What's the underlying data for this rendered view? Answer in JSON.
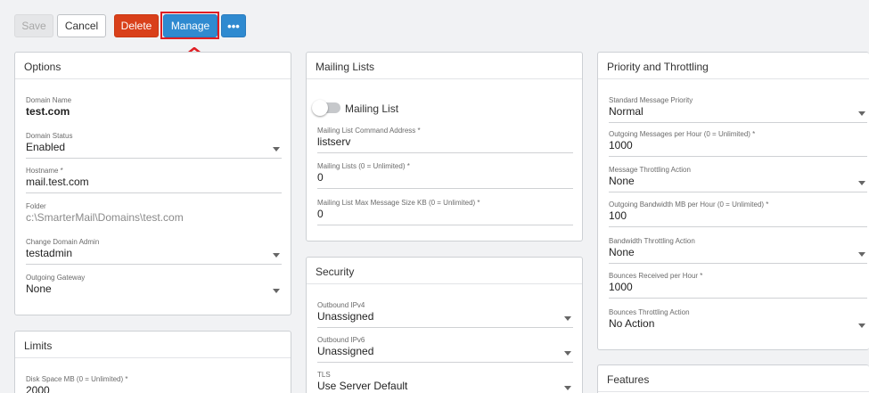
{
  "toolbar": {
    "save": "Save",
    "cancel": "Cancel",
    "delete": "Delete",
    "manage": "Manage",
    "more": "•••"
  },
  "options": {
    "title": "Options",
    "domain_name_label": "Domain Name",
    "domain_name_value": "test.com",
    "domain_status_label": "Domain Status",
    "domain_status_value": "Enabled",
    "hostname_label": "Hostname *",
    "hostname_value": "mail.test.com",
    "folder_label": "Folder",
    "folder_value": "c:\\SmarterMail\\Domains\\test.com",
    "change_admin_label": "Change Domain Admin",
    "change_admin_value": "testadmin",
    "outgoing_gateway_label": "Outgoing Gateway",
    "outgoing_gateway_value": "None"
  },
  "limits": {
    "title": "Limits",
    "disk_space_label": "Disk Space MB (0 = Unlimited) *",
    "disk_space_value": "2000"
  },
  "mailing_lists": {
    "title": "Mailing Lists",
    "toggle_label": "Mailing List",
    "toggle_on": false,
    "command_address_label": "Mailing List Command Address *",
    "command_address_value": "listserv",
    "lists_label": "Mailing Lists (0 = Unlimited) *",
    "lists_value": "0",
    "max_size_label": "Mailing List Max Message Size KB (0 = Unlimited) *",
    "max_size_value": "0"
  },
  "security": {
    "title": "Security",
    "ipv4_label": "Outbound IPv4",
    "ipv4_value": "Unassigned",
    "ipv6_label": "Outbound IPv6",
    "ipv6_value": "Unassigned",
    "tls_label": "TLS",
    "tls_value": "Use Server Default"
  },
  "priority": {
    "title": "Priority and Throttling",
    "std_priority_label": "Standard Message Priority",
    "std_priority_value": "Normal",
    "out_msgs_label": "Outgoing Messages per Hour (0 = Unlimited) *",
    "out_msgs_value": "1000",
    "msg_throttle_label": "Message Throttling Action",
    "msg_throttle_value": "None",
    "out_bw_label": "Outgoing Bandwidth MB per Hour (0 = Unlimited) *",
    "out_bw_value": "100",
    "bw_throttle_label": "Bandwidth Throttling Action",
    "bw_throttle_value": "None",
    "bounces_label": "Bounces Received per Hour *",
    "bounces_value": "1000",
    "bounces_throttle_label": "Bounces Throttling Action",
    "bounces_throttle_value": "No Action"
  },
  "features": {
    "title": "Features"
  },
  "colors": {
    "delete": "#d9401a",
    "primary": "#2f8ad0",
    "highlight": "#e01e23"
  }
}
